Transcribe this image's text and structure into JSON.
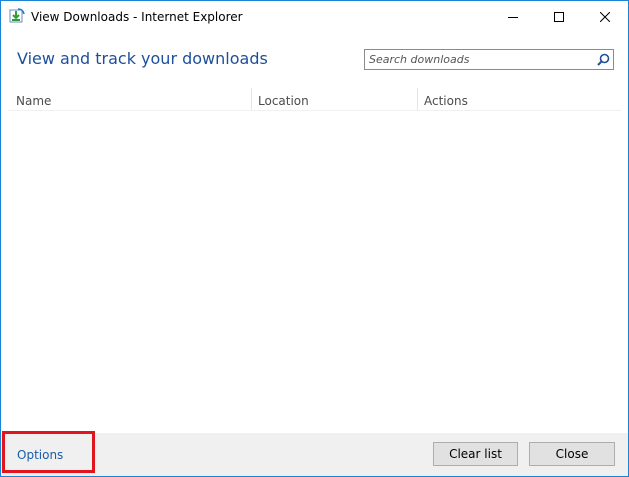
{
  "window": {
    "title": "View Downloads - Internet Explorer",
    "app_icon": "ie-downloads-icon",
    "caption_buttons": [
      "minimize-icon",
      "maximize-icon",
      "close-icon"
    ]
  },
  "header": {
    "title": "View and track your downloads"
  },
  "search": {
    "placeholder": "Search downloads",
    "value": "",
    "icon": "search-icon"
  },
  "list": {
    "columns": [
      "Name",
      "Location",
      "Actions"
    ],
    "rows": []
  },
  "footer": {
    "options_label": "Options",
    "clear_list_label": "Clear list",
    "close_label": "Close"
  },
  "colors": {
    "accent": "#1e4f9c",
    "link": "#1a5ca8",
    "window_border": "#1883d7",
    "highlight": "#e0161f",
    "footer_bg": "#f0f0f0"
  }
}
